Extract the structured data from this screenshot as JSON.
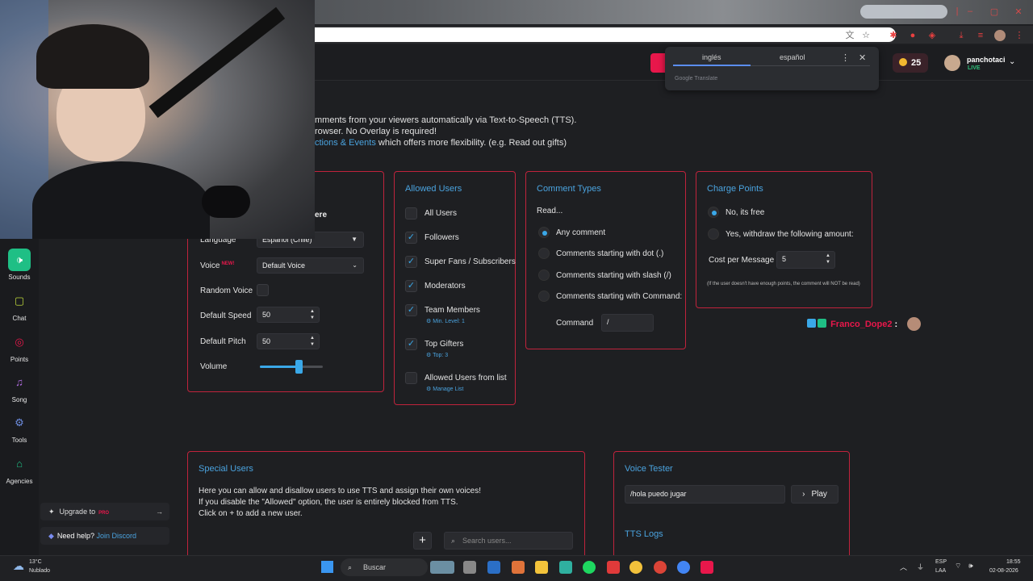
{
  "translate": {
    "tab_english": "inglés",
    "tab_spanish": "español",
    "footer": "Google Translate",
    "menu_icon": "kebab-icon",
    "close_icon": "close-icon"
  },
  "header": {
    "coins": "25",
    "username": "panchotaci",
    "status": "LIVE"
  },
  "intro": {
    "line1": "mments from your viewers automatically via Text-to-Speech (TTS).",
    "line2": "rowser. No Overlay is required!",
    "line3_link": "ctions & Events",
    "line3_rest": " which offers more flexibility. (e.g. Read out gifts)"
  },
  "sidebar": {
    "items": [
      {
        "label": "Sounds",
        "icon": "speaker-icon",
        "active": true
      },
      {
        "label": "Chat",
        "icon": "chat-icon"
      },
      {
        "label": "Points",
        "icon": "points-icon"
      },
      {
        "label": "Song",
        "icon": "music-icon"
      },
      {
        "label": "Tools",
        "icon": "tools-icon"
      },
      {
        "label": "Agencies",
        "icon": "agencies-icon"
      }
    ],
    "upgrade_label": "Upgrade to",
    "upgrade_badge": "PRO",
    "help_label": "Need help?",
    "help_link": "Join Discord"
  },
  "settings": {
    "partial_title": "ere",
    "language_label": "Language",
    "language_value": "Español (Chile)",
    "voice_label": "Voice",
    "voice_badge": "NEW!",
    "voice_value": "Default Voice",
    "random_voice_label": "Random Voice",
    "speed_label": "Default Speed",
    "speed_value": "50",
    "pitch_label": "Default Pitch",
    "pitch_value": "50",
    "volume_label": "Volume",
    "volume_level": 0.62
  },
  "allowed_users": {
    "title": "Allowed Users",
    "items": [
      {
        "label": "All Users",
        "checked": false
      },
      {
        "label": "Followers",
        "checked": true
      },
      {
        "label": "Super Fans / Subscribers",
        "checked": true
      },
      {
        "label": "Moderators",
        "checked": true
      },
      {
        "label": "Team Members",
        "checked": true,
        "sub": "Min. Level: 1"
      },
      {
        "label": "Top Gifters",
        "checked": true,
        "sub": "Top: 3"
      },
      {
        "label": "Allowed Users from list",
        "checked": false,
        "sub": "Manage List"
      }
    ]
  },
  "comment_types": {
    "title": "Comment Types",
    "read_label": "Read...",
    "options": [
      {
        "label": "Any comment",
        "selected": true
      },
      {
        "label": "Comments starting with dot (.)",
        "selected": false
      },
      {
        "label": "Comments starting with slash (/)",
        "selected": false
      },
      {
        "label": "Comments starting with Command:",
        "selected": false
      }
    ],
    "command_label": "Command",
    "command_value": "/"
  },
  "charge_points": {
    "title": "Charge Points",
    "option_free": "No, its free",
    "option_withdraw": "Yes, withdraw the following amount:",
    "cost_label": "Cost per Message",
    "cost_value": "5",
    "note": "(If the user doesn't have enough points, the comment will NOT be read)"
  },
  "chat_overlay": {
    "name": "Franco_Dope2",
    "separator": ":"
  },
  "special_users": {
    "title": "Special Users",
    "line1": "Here you can allow and disallow users to use TTS and assign their own voices!",
    "line2": "If you disable the \"Allowed\" option, the user is entirely blocked from TTS.",
    "line3": "Click on + to add a new user.",
    "add_label": "+",
    "search_placeholder": "Search users..."
  },
  "voice_tester": {
    "title": "Voice Tester",
    "input_value": "/hola puedo jugar",
    "play_label": "Play",
    "logs_title": "TTS Logs"
  },
  "taskbar": {
    "weather_temp": "13°C",
    "weather_desc": "Nublado",
    "search_label": "Buscar",
    "lang_top": "ESP",
    "lang_bottom": "LAA",
    "time": "18:55",
    "date": "02-08-2026"
  },
  "colors": {
    "accent": "#3aa8e8",
    "brand": "#e8174b",
    "panel_border": "#c0233c",
    "success": "#1fbf85"
  }
}
